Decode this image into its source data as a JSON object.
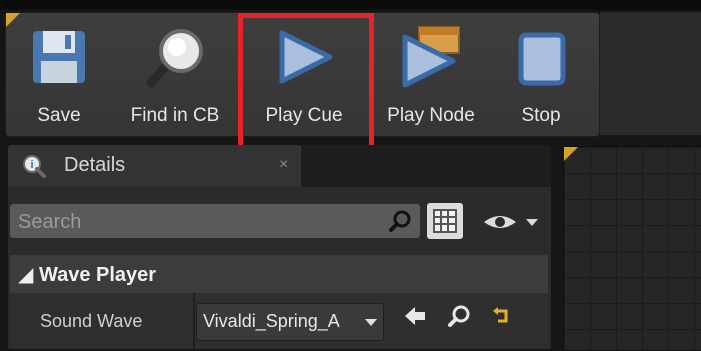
{
  "toolbar": {
    "buttons": [
      {
        "label": "Save",
        "icon": "floppy-disk-icon"
      },
      {
        "label": "Find in CB",
        "icon": "magnifier-icon"
      },
      {
        "label": "Play Cue",
        "icon": "play-triangle-icon"
      },
      {
        "label": "Play Node",
        "icon": "play-node-icon"
      },
      {
        "label": "Stop",
        "icon": "stop-square-icon"
      }
    ]
  },
  "details": {
    "tab_label": "Details",
    "close_glyph": "×",
    "search_placeholder": "Search"
  },
  "wave_player": {
    "category": "Wave Player",
    "sound_wave_label": "Sound Wave",
    "sound_wave_value": "Vivaldi_Spring_A"
  },
  "colors": {
    "highlight": "#e3242b",
    "accent": "#d7a22a"
  }
}
